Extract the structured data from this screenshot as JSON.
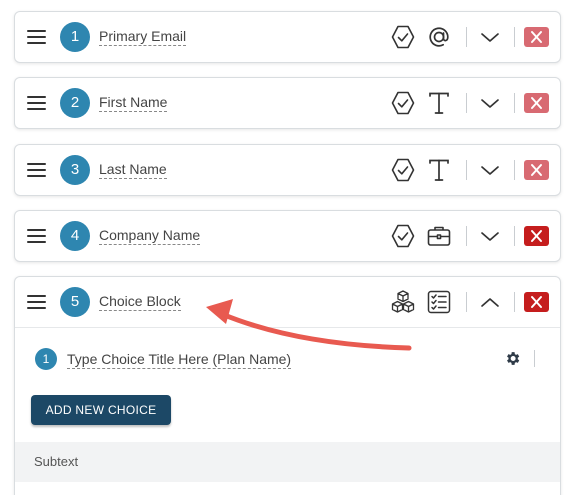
{
  "fields": [
    {
      "number": "1",
      "label": "Primary Email",
      "type_icon": "at-sign-icon",
      "status_icon": "verified-hexagon-icon",
      "chevron": "chevron-down-icon"
    },
    {
      "number": "2",
      "label": "First Name",
      "type_icon": "text-type-icon",
      "status_icon": "verified-hexagon-icon",
      "chevron": "chevron-down-icon"
    },
    {
      "number": "3",
      "label": "Last Name",
      "type_icon": "text-type-icon",
      "status_icon": "verified-hexagon-icon",
      "chevron": "chevron-down-icon"
    },
    {
      "number": "4",
      "label": "Company Name",
      "type_icon": "briefcase-icon",
      "status_icon": "verified-hexagon-icon",
      "chevron": "chevron-down-icon"
    },
    {
      "number": "5",
      "label": "Choice Block",
      "type_icon": "checklist-icon",
      "status_icon": "cubes-icon",
      "chevron": "chevron-up-icon"
    }
  ],
  "choice_block": {
    "choices": [
      {
        "number": "1",
        "title": "Type Choice Title Here (Plan Name)"
      }
    ],
    "add_button_label": "ADD NEW CHOICE",
    "subtext_label": "Subtext"
  },
  "colors": {
    "badge": "#2e86b0",
    "close_light": "#d86a72",
    "close_dark": "#c51d1d",
    "primary_button": "#1c4866",
    "annotation_arrow": "#e85a50"
  },
  "annotation": {
    "type": "arrow",
    "target": "Choice Block"
  }
}
